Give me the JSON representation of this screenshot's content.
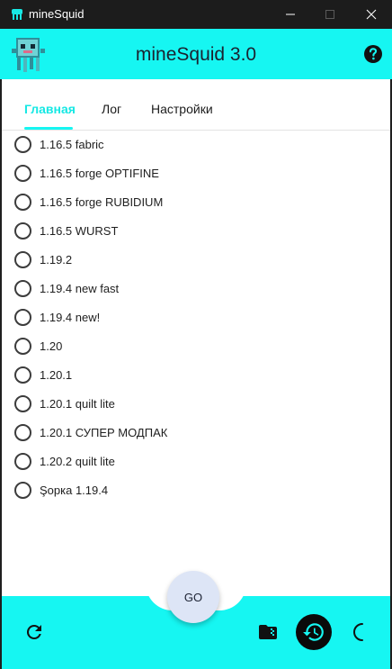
{
  "window": {
    "title": "mineSquid",
    "icons": {
      "app": "squid-app-icon",
      "minimize": "minimize-icon",
      "maximize": "maximize-icon",
      "close": "close-icon"
    }
  },
  "header": {
    "title": "mineSquid 3.0",
    "logo_icon": "squid-logo-icon",
    "help_icon": "help-icon",
    "accent_color": "#16f6f2"
  },
  "tabs": [
    {
      "label": "Главная",
      "active": true
    },
    {
      "label": "Лог",
      "active": false
    },
    {
      "label": "Настройки",
      "active": false
    }
  ],
  "versions": [
    "1.16.5 fabric",
    "1.16.5 forge OPTIFINE",
    "1.16.5 forge RUBIDIUM",
    "1.16.5 WURST",
    "1.19.2",
    "1.19.4 new fast",
    "1.19.4 new!",
    "1.20",
    "1.20.1",
    "1.20.1 quilt lite",
    "1.20.1 СУПЕР МОДПАК",
    "1.20.2 quilt lite",
    "Şорка 1.19.4"
  ],
  "bottom": {
    "go_label": "GO",
    "refresh_icon": "refresh-icon",
    "folder_icon": "folder-zip-icon",
    "history_icon": "history-icon",
    "theme_icon": "moon-icon"
  }
}
